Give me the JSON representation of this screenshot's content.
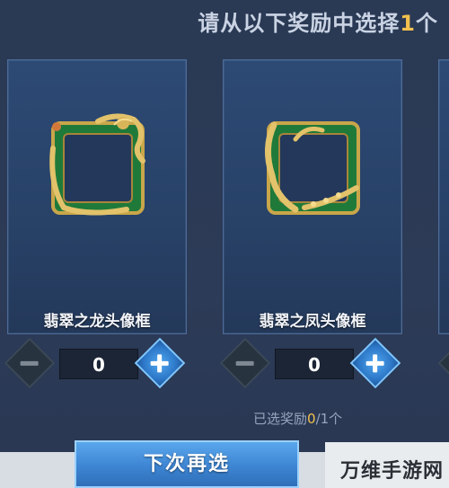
{
  "header": {
    "prefix": "请从以下奖励中选择",
    "count": "1",
    "suffix": "个"
  },
  "rewards": [
    {
      "name": "翡翠之龙头像框",
      "quantity": "0",
      "icon": "jade-dragon-frame-icon"
    },
    {
      "name": "翡翠之凤头像框",
      "quantity": "0",
      "icon": "jade-phoenix-frame-icon"
    }
  ],
  "selection": {
    "prefix": "已选奖励",
    "current": "0",
    "suffix": "/1个"
  },
  "reroll_button": {
    "label": "下次再选"
  },
  "watermark": {
    "text": "万维手游网"
  },
  "colors": {
    "accent_gold": "#f2c14e",
    "card_blue": "#2d4a75",
    "button_blue": "#3b82d0",
    "frame_green": "#1f7a3a"
  }
}
